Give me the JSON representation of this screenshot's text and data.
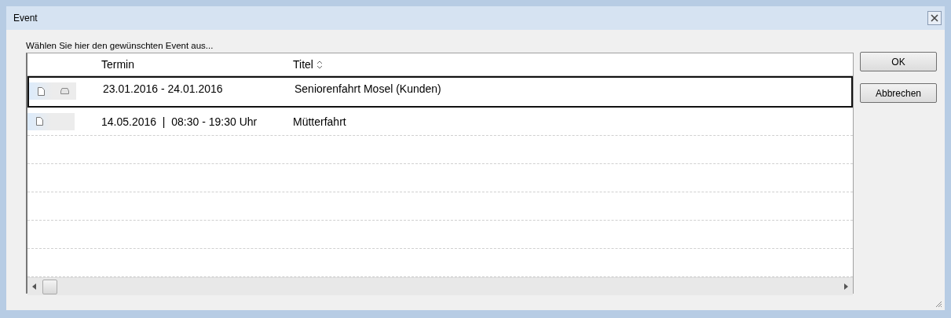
{
  "window": {
    "title": "Event"
  },
  "prompt": "Wählen Sie hier den gewünschten Event aus...",
  "table": {
    "columns": [
      {
        "label": "Termin",
        "sort_icon": false
      },
      {
        "label": "Titel",
        "sort_icon": true
      }
    ],
    "rows": [
      {
        "termin": "23.01.2016 - 24.01.2016",
        "titel": "Seniorenfahrt Mosel (Kunden)",
        "selected": true,
        "tray_icon": true
      },
      {
        "termin": "14.05.2016  |  08:30 - 19:30 Uhr",
        "titel": "Mütterfahrt",
        "selected": false,
        "tray_icon": false
      }
    ]
  },
  "buttons": [
    "OK",
    "Abbrechen"
  ]
}
